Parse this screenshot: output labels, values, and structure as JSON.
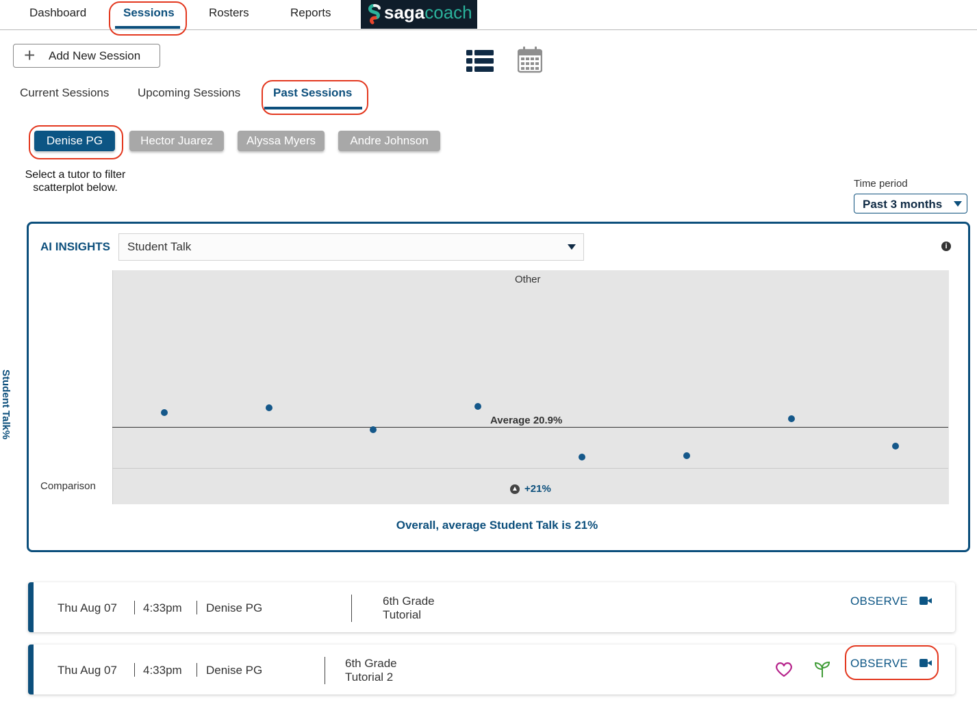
{
  "nav": {
    "items": [
      {
        "label": "Dashboard"
      },
      {
        "label": "Sessions"
      },
      {
        "label": "Rosters"
      },
      {
        "label": "Reports"
      }
    ],
    "active": "Sessions",
    "logo_part1": "saga",
    "logo_part2": "coach"
  },
  "toolbar": {
    "add_session_label": "Add New Session",
    "views": [
      "list-view-icon",
      "calendar-view-icon"
    ]
  },
  "tabs": [
    {
      "label": "Current Sessions"
    },
    {
      "label": "Upcoming Sessions"
    },
    {
      "label": "Past Sessions"
    }
  ],
  "active_tab": "Past Sessions",
  "tutors": [
    {
      "label": "Denise PG"
    },
    {
      "label": "Hector Juarez"
    },
    {
      "label": "Alyssa Myers"
    },
    {
      "label": "Andre Johnson"
    }
  ],
  "selected_tutor": "Denise PG",
  "helper_text": "Select a tutor to filter scatterplot below.",
  "time_period": {
    "label": "Time period",
    "value": "Past 3 months"
  },
  "insights": {
    "title": "AI INSIGHTS",
    "metric": "Student Talk",
    "y_label": "Student Talk%",
    "category": "Other",
    "average_label": "Average 20.9%",
    "comparison_label": "Comparison",
    "comparison_value": "+21%",
    "summary": "Overall, average Student Talk is 21%"
  },
  "chart_data": {
    "type": "scatter",
    "ylabel": "Student Talk%",
    "average": 20.9,
    "points": [
      {
        "x": 1,
        "y": 22.1
      },
      {
        "x": 2,
        "y": 22.5
      },
      {
        "x": 3,
        "y": 20.7
      },
      {
        "x": 4,
        "y": 22.6
      },
      {
        "x": 5,
        "y": 18.4
      },
      {
        "x": 6,
        "y": 18.5
      },
      {
        "x": 7,
        "y": 21.6
      },
      {
        "x": 8,
        "y": 19.3
      }
    ]
  },
  "sessions": [
    {
      "date": "Thu Aug 07",
      "time": "4:33pm",
      "tutor": "Denise PG",
      "title_line1": "6th Grade",
      "title_line2": "Tutorial",
      "action": "OBSERVE"
    },
    {
      "date": "Thu Aug 07",
      "time": "4:33pm",
      "tutor": "Denise PG",
      "title_line1": "6th Grade",
      "title_line2": "Tutorial 2",
      "action": "OBSERVE"
    }
  ],
  "colors": {
    "brand": "#0c4f7c",
    "callout": "#e3371e",
    "chip_inactive": "#a8a8a8",
    "heart": "#b5218a",
    "sprout": "#3e9b35"
  }
}
